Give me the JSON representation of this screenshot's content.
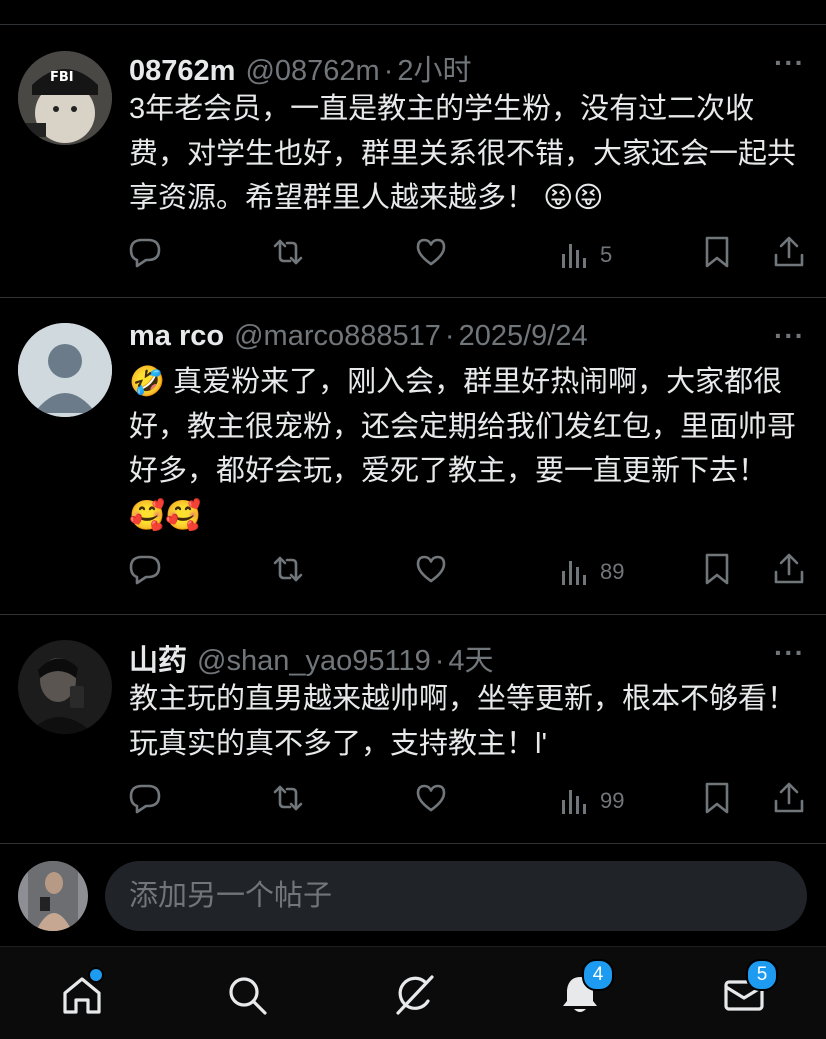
{
  "posts": [
    {
      "name": "08762m",
      "handle": "@08762m",
      "time": "2小时",
      "text": "3年老会员，一直是教主的学生粉，没有过二次收费，对学生也好，群里关系很不错，大家还会一起共享资源。希望群里人越来越多！",
      "emojis": "😝😝",
      "views": "5",
      "avatar_label": "FBI"
    },
    {
      "name": "ma rco",
      "handle": "@marco888517",
      "time": "2025/9/24",
      "emoji_lead": "🤣",
      "text": "真爱粉来了，刚入会，群里好热闹啊，大家都很好，教主很宠粉，还会定期给我们发红包，里面帅哥好多，都好会玩，爱死了教主，要一直更新下去！",
      "emojis": "🥰🥰",
      "views": "89"
    },
    {
      "name": "山药",
      "handle": "@shan_yao95119",
      "time": "4天",
      "text": "教主玩的直男越来越帅啊，坐等更新，根本不够看！玩真实的真不多了，支持教主！l'",
      "views": "99"
    }
  ],
  "reply": {
    "placeholder": "添加另一个帖子"
  },
  "tabs": {
    "notifications_badge": "4",
    "messages_badge": "5"
  },
  "colors": {
    "accent": "#1d9bf0",
    "muted": "#71767b",
    "text": "#e7e9ea",
    "divider": "#2f3336"
  },
  "icons": [
    "reply-icon",
    "repost-icon",
    "like-icon",
    "views-icon",
    "bookmark-icon",
    "share-icon",
    "home-icon",
    "search-icon",
    "grok-icon",
    "bell-icon",
    "mail-icon",
    "more-icon"
  ]
}
